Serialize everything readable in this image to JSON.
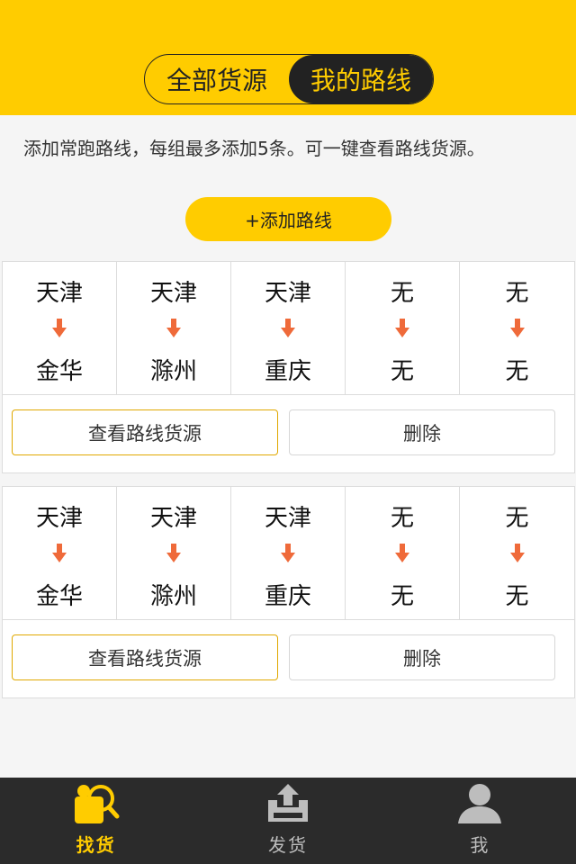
{
  "header": {
    "segments": [
      {
        "label": "全部货源",
        "active": false
      },
      {
        "label": "我的路线",
        "active": true
      }
    ]
  },
  "tip": "添加常跑路线，每组最多添加5条。可一键查看路线货源。",
  "add_button": "+添加路线",
  "routes": [
    {
      "cells": [
        {
          "from": "天津",
          "to": "金华"
        },
        {
          "from": "天津",
          "to": "滁州"
        },
        {
          "from": "天津",
          "to": "重庆"
        },
        {
          "from": "无",
          "to": "无"
        },
        {
          "from": "无",
          "to": "无"
        }
      ],
      "view_label": "查看路线货源",
      "delete_label": "删除"
    },
    {
      "cells": [
        {
          "from": "天津",
          "to": "金华"
        },
        {
          "from": "天津",
          "to": "滁州"
        },
        {
          "from": "天津",
          "to": "重庆"
        },
        {
          "from": "无",
          "to": "无"
        },
        {
          "from": "无",
          "to": "无"
        }
      ],
      "view_label": "查看路线货源",
      "delete_label": "删除"
    }
  ],
  "tabbar": [
    {
      "label": "找货",
      "icon": "search-cargo-icon",
      "active": true
    },
    {
      "label": "发货",
      "icon": "ship-box-icon",
      "active": false
    },
    {
      "label": "我",
      "icon": "user-icon",
      "active": false
    }
  ],
  "colors": {
    "brand_yellow": "#ffcc00",
    "arrow_orange": "#ef6a3a",
    "dark": "#2b2b2b"
  }
}
